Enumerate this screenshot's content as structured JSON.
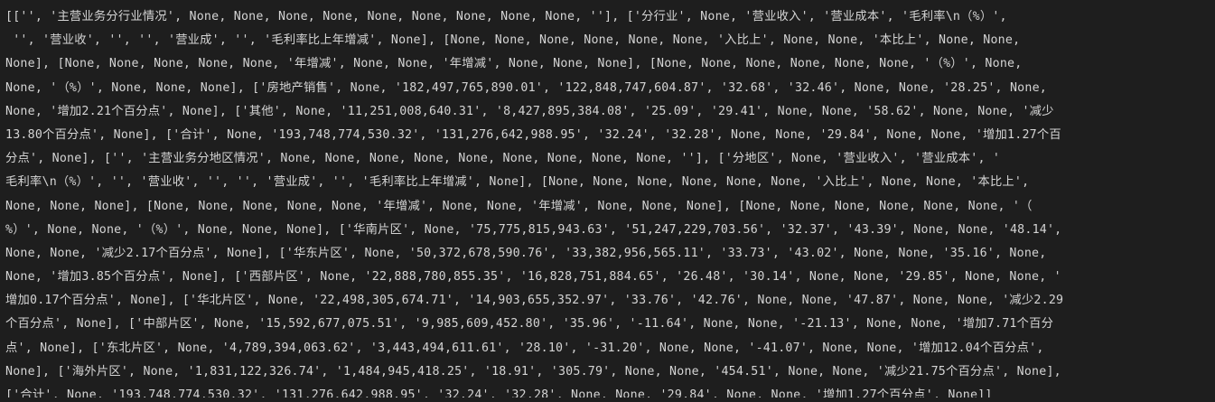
{
  "console": {
    "lines": [
      "[['', '主营业务分行业情况', None, None, None, None, None, None, None, None, None, ''], ['分行业', None, '营业收入', '营业成本', '毛利率\\n（%）',",
      " '', '营业收', '', '', '营业成', '', '毛利率比上年增减', None], [None, None, None, None, None, None, '入比上', None, None, '本比上', None, None,",
      "None], [None, None, None, None, None, '年增减', None, None, '年增减', None, None, None], [None, None, None, None, None, None, '（%）', None,",
      "None, '（%）', None, None, None], ['房地产销售', None, '182,497,765,890.01', '122,848,747,604.87', '32.68', '32.46', None, None, '28.25', None,",
      "None, '增加2.21个百分点', None], ['其他', None, '11,251,008,640.31', '8,427,895,384.08', '25.09', '29.41', None, None, '58.62', None, None, '减少",
      "13.80个百分点', None], ['合计', None, '193,748,774,530.32', '131,276,642,988.95', '32.24', '32.28', None, None, '29.84', None, None, '增加1.27个百",
      "分点', None], ['', '主营业务分地区情况', None, None, None, None, None, None, None, None, None, ''], ['分地区', None, '营业收入', '营业成本', '",
      "毛利率\\n（%）', '', '营业收', '', '', '营业成', '', '毛利率比上年增减', None], [None, None, None, None, None, None, '入比上', None, None, '本比上',",
      "None, None, None], [None, None, None, None, None, '年增减', None, None, '年增减', None, None, None], [None, None, None, None, None, None, '（",
      "%）', None, None, '（%）', None, None, None], ['华南片区', None, '75,775,815,943.63', '51,247,229,703.56', '32.37', '43.39', None, None, '48.14',",
      "None, None, '减少2.17个百分点', None], ['华东片区', None, '50,372,678,590.76', '33,382,956,565.11', '33.73', '43.02', None, None, '35.16', None,",
      "None, '增加3.85个百分点', None], ['西部片区', None, '22,888,780,855.35', '16,828,751,884.65', '26.48', '30.14', None, None, '29.85', None, None, '",
      "增加0.17个百分点', None], ['华北片区', None, '22,498,305,674.71', '14,903,655,352.97', '33.76', '42.76', None, None, '47.87', None, None, '减少2.29",
      "个百分点', None], ['中部片区', None, '15,592,677,075.51', '9,985,609,452.80', '35.96', '-11.64', None, None, '-21.13', None, None, '增加7.71个百分",
      "点', None], ['东北片区', None, '4,789,394,063.62', '3,443,494,611.61', '28.10', '-31.20', None, None, '-41.07', None, None, '增加12.04个百分点',",
      "None], ['海外片区', None, '1,831,122,326.74', '1,484,945,418.25', '18.91', '305.79', None, None, '454.51', None, None, '减少21.75个百分点', None],",
      "['合计', None, '193,748,774,530.32', '131,276,642,988.95', '32.24', '32.28', None, None, '29.84', None, None, '增加1.27个百分点', None]]"
    ]
  }
}
